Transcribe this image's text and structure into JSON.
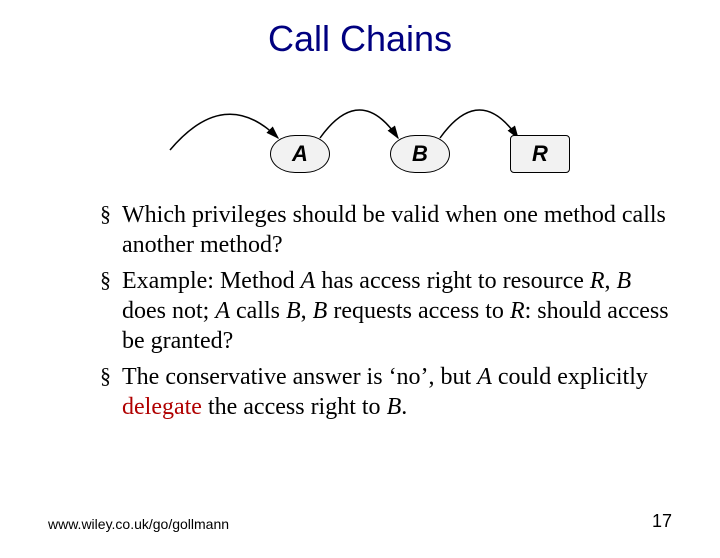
{
  "title": "Call Chains",
  "diagram": {
    "nodeA": "A",
    "nodeB": "B",
    "nodeR": "R"
  },
  "bullets": {
    "b1": "Which privileges should be valid when one method calls another method?",
    "b2_pre": "Example: Method ",
    "b2_A": "A",
    "b2_mid1": " has access right to resource ",
    "b2_R1": "R",
    "b2_mid2": ", ",
    "b2_B1": "B",
    "b2_mid3": " does not; ",
    "b2_A2": "A",
    "b2_mid4": " calls ",
    "b2_B2": "B",
    "b2_mid5": ", ",
    "b2_B3": "B",
    "b2_mid6": " requests access to ",
    "b2_R2": "R",
    "b2_end": ": should access be granted?",
    "b3_pre": "The conservative answer is ‘no’, but ",
    "b3_A": "A",
    "b3_mid": " could explicitly ",
    "b3_delegate": "delegate",
    "b3_mid2": " the access right to ",
    "b3_B": "B",
    "b3_end": "."
  },
  "footer": {
    "url": "www.wiley.co.uk/go/gollmann",
    "page": "17"
  }
}
